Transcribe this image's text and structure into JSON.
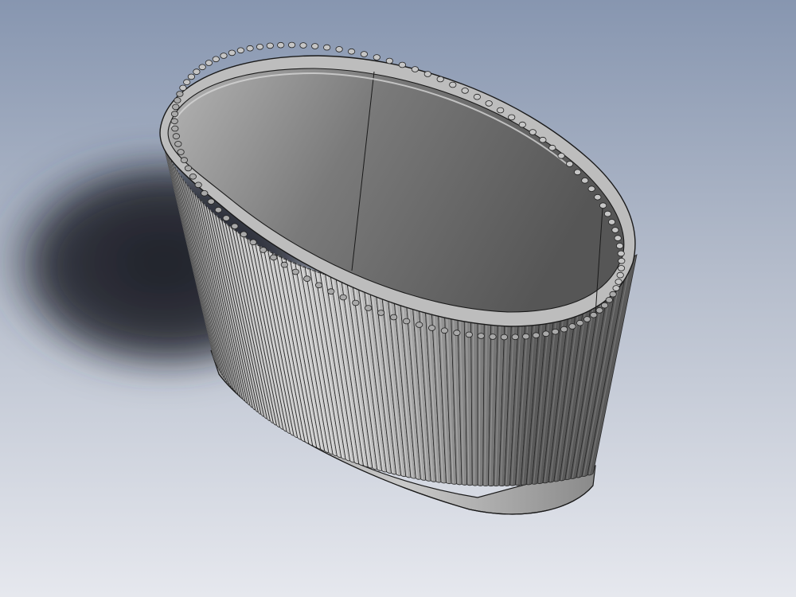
{
  "scene": {
    "description_type": "cad-render",
    "colors": {
      "background_top": "#8796b0",
      "background_bottom": "#e6e8ee",
      "shadow": "#1c1f26",
      "model_light": "#bdbdbd",
      "model_mid": "#8a8a8a",
      "model_dark": "#3d3d3d",
      "edge": "#1a1a1a"
    },
    "model": {
      "shape": "oval fluted planter",
      "rib_count": 96
    }
  }
}
